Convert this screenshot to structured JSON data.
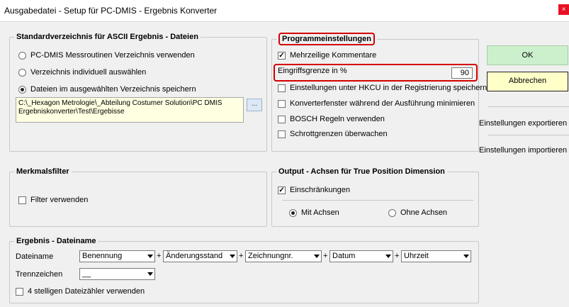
{
  "window": {
    "title": "Ausgabedatei - Setup für  PC-DMIS - Ergebnis Konverter",
    "close_glyph": "×"
  },
  "standard": {
    "legend": "Standardverzeichnis für ASCII Ergebnis - Dateien",
    "options": [
      {
        "label": "PC-DMIS Messroutinen Verzeichnis verwenden",
        "checked": false
      },
      {
        "label": "Verzeichnis individuell auswählen",
        "checked": false
      },
      {
        "label": "Dateien im ausgewählten Verzeichnis speichern",
        "checked": true
      }
    ],
    "path_line1": "C:\\_Hexagon Metrologie\\_Abteilung Costumer Solution\\PC DMIS",
    "path_line2": "Ergebniskonverter\\Test\\Ergebisse",
    "browse_label": "..."
  },
  "program": {
    "legend": "Programmeinstellungen",
    "multiline": {
      "label": "Mehrzeilige Kommentare",
      "checked": true
    },
    "limit_label": "Eingriffsgrenze in %",
    "limit_value": "90",
    "options": [
      {
        "label": "Einstellungen unter HKCU in der Registrierung speichern",
        "checked": false
      },
      {
        "label": "Konverterfenster während der Ausführung minimieren",
        "checked": false
      },
      {
        "label": "BOSCH Regeln verwenden",
        "checked": false
      },
      {
        "label": "Schrottgrenzen überwachen",
        "checked": false
      }
    ]
  },
  "buttons": {
    "ok": "OK",
    "cancel": "Abbrechen",
    "export": "Einstellungen exportieren",
    "import": "Einstellungen importieren"
  },
  "filter": {
    "legend": "Merkmalsfilter",
    "use_filter": {
      "label": "Filter verwenden",
      "checked": false
    }
  },
  "output": {
    "legend": "Output - Achsen für True Position Dimension",
    "restrictions": {
      "label": "Einschränkungen",
      "checked": true
    },
    "with_axes": {
      "label": "Mit Achsen",
      "checked": true
    },
    "without_axes": {
      "label": "Ohne Achsen",
      "checked": false
    }
  },
  "filename": {
    "legend": "Ergebnis - Dateiname",
    "name_label": "Dateiname",
    "parts": [
      "Benennung",
      "Änderungsstand",
      "Zeichnungnr.",
      "Datum",
      "Uhrzeit"
    ],
    "plus": "+",
    "separator_label": "Trennzeichen",
    "separator_value": "__",
    "counter": {
      "label": "4 stelligen Dateizähler verwenden",
      "checked": false
    }
  },
  "colors": {
    "highlight_red": "#d40000",
    "ok_green": "#ccf0cc",
    "cancel_yellow": "#ffffc8",
    "path_bg": "#ffffe1",
    "close_red": "#e81123"
  },
  "icons": {
    "close": "close-icon",
    "dropdown": "chevron-down-icon"
  }
}
